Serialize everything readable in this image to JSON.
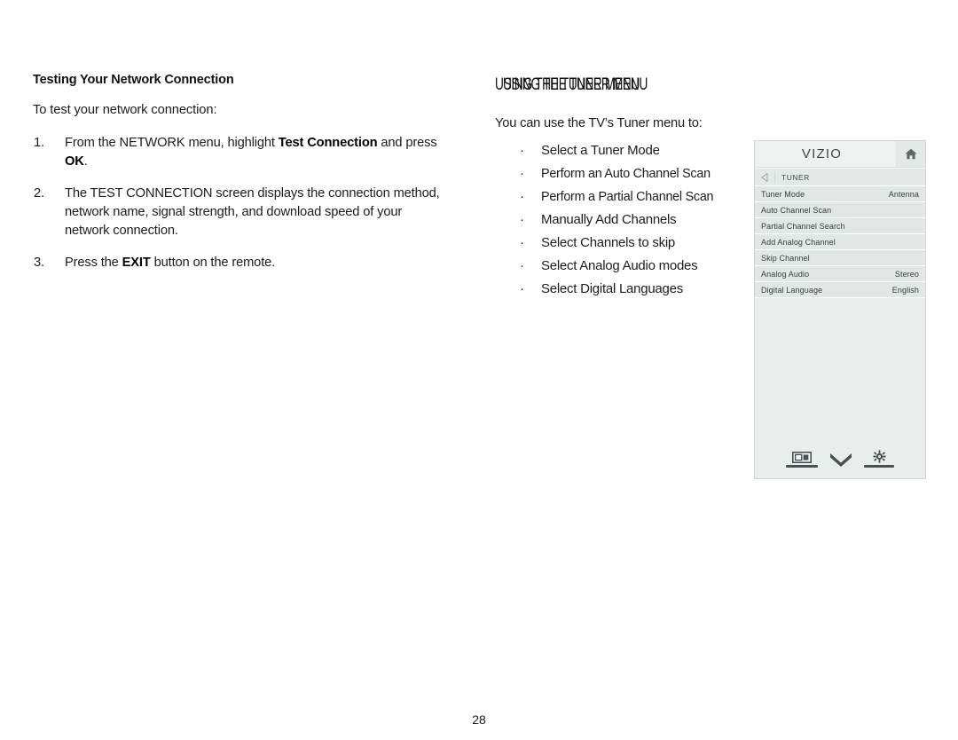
{
  "document": {
    "page_number": "28"
  },
  "left_column": {
    "heading": "Testing Your Network Connection",
    "intro": "To test your network connection:",
    "steps": [
      {
        "number": "1.",
        "parts": [
          {
            "text": "From the NETWORK menu, highlight ",
            "bold": false
          },
          {
            "text": "Test Connection",
            "bold": true
          },
          {
            "text": " and press ",
            "bold": false
          },
          {
            "text": "OK",
            "bold": true
          },
          {
            "text": ".",
            "bold": false
          }
        ]
      },
      {
        "number": "2.",
        "parts": [
          {
            "text": "The TEST CONNECTION screen displays the connection method, network name, signal strength, and download speed of your network connection.",
            "bold": false
          }
        ]
      },
      {
        "number": "3.",
        "parts": [
          {
            "text": "Press the ",
            "bold": false
          },
          {
            "text": "EXIT",
            "bold": true
          },
          {
            "text": " button on the remote.",
            "bold": false
          }
        ]
      }
    ]
  },
  "right_column": {
    "heading_rendered": "SINGHETNIEBRNU",
    "heading_layer_a": "USING THE TUNER MENU",
    "heading_layer_b": "USING THE TUNER MENU",
    "lead": "You can use the TV’s Tuner menu to:",
    "bullet_char": "·",
    "bullets": [
      {
        "text": "Select a Tuner Mode",
        "condensed": false
      },
      {
        "text": "Perform an Auto Channel Scan",
        "condensed": true
      },
      {
        "text": "Perform a Partial Channel Scan",
        "condensed": true
      },
      {
        "text": "Manually Add Channels",
        "condensed": false
      },
      {
        "text": "Select Channels to skip",
        "condensed": false
      },
      {
        "text": "Select Analog Audio modes",
        "condensed": false
      },
      {
        "text": "Select Digital Languages",
        "condensed": false
      }
    ]
  },
  "tv_menu": {
    "brand": "VIZIO",
    "home_icon": "home-icon",
    "back_icon": "back-arrow-icon",
    "breadcrumb": "TUNER",
    "rows": [
      {
        "label": "Tuner Mode",
        "value": "Antenna"
      },
      {
        "label": "Auto Channel Scan",
        "value": ""
      },
      {
        "label": "Partial Channel Search",
        "value": ""
      },
      {
        "label": "Add Analog Channel",
        "value": ""
      },
      {
        "label": "Skip Channel",
        "value": ""
      },
      {
        "label": "Analog Audio",
        "value": "Stereo"
      },
      {
        "label": "Digital Language",
        "value": "English"
      }
    ],
    "footer_icons": [
      {
        "name": "screen-display-icon"
      },
      {
        "name": "chevron-down-icon"
      },
      {
        "name": "gear-icon"
      }
    ],
    "colors": {
      "panel_background": "#e9edec",
      "row_background": "#e2e7e6",
      "header_background": "#eef1f0",
      "text": "#363d3e",
      "border": "#cfd6d5"
    }
  }
}
